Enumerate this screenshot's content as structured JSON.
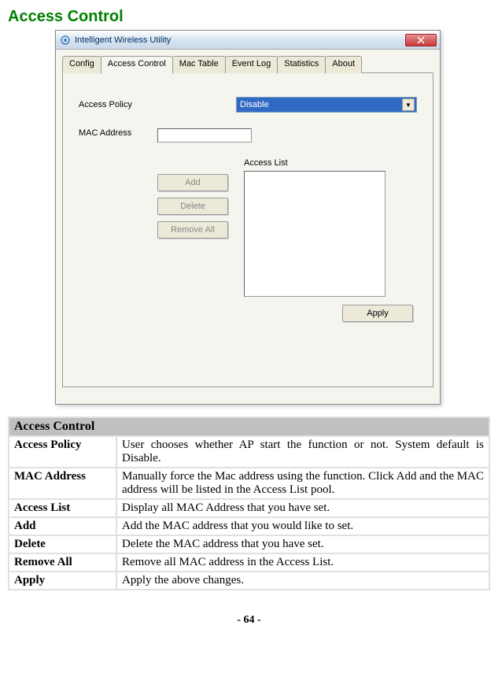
{
  "heading": "Access Control",
  "window": {
    "title": "Intelligent Wireless Utility",
    "tabs": [
      "Config",
      "Access Control",
      "Mac Table",
      "Event Log",
      "Statistics",
      "About"
    ],
    "active_tab_index": 1,
    "labels": {
      "access_policy": "Access Policy",
      "mac_address": "MAC Address",
      "access_list": "Access List"
    },
    "dropdown_value": "Disable",
    "buttons": {
      "add": "Add",
      "delete": "Delete",
      "remove_all": "Remove All",
      "apply": "Apply"
    }
  },
  "table": {
    "header": "Access Control",
    "rows": [
      {
        "key": "Access Policy",
        "val": "User chooses whether AP start the function or not. System default is Disable."
      },
      {
        "key": "MAC Address",
        "val": "Manually force the Mac address using the function. Click Add and the MAC address will be listed in the Access List pool."
      },
      {
        "key": "Access List",
        "val": "Display all MAC Address that you have set."
      },
      {
        "key": "Add",
        "val": "Add the MAC address that you would like to set."
      },
      {
        "key": "Delete",
        "val": "Delete the MAC address that you have set."
      },
      {
        "key": "Remove All",
        "val": "Remove all MAC address in the Access List."
      },
      {
        "key": "Apply",
        "val": "Apply the above changes."
      }
    ]
  },
  "page_number": "- 64 -"
}
